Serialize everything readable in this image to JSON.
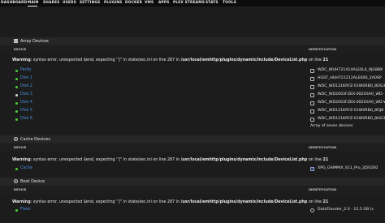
{
  "nav": [
    "DASHBOARD",
    "MAIN",
    "SHARES",
    "USERS",
    "SETTINGS",
    "PLUGINS",
    "DOCKER",
    "VMS",
    "APPS",
    "PLEX STREAMS",
    "STATS",
    "TOOLS"
  ],
  "columns": {
    "device": "DEVICE",
    "identification": "IDENTIFICATION"
  },
  "warning": {
    "label": "Warning",
    "text": ": syntax error, unexpected $end, expecting '']'' in state/sec.ini on line 287 in ",
    "path": "/usr/local/emhttp/plugins/dynamix/include/DeviceList.php",
    "line_prefix": " on line ",
    "line": "21"
  },
  "array": {
    "title": "Array Devices",
    "devices": [
      {
        "name": "Parity",
        "ident": "WDC_WUH721414ALE6L4_9JG8BK",
        "status": "green"
      },
      {
        "name": "Disk 1",
        "ident": "HGST_HUH721212ALE600_2A0SP",
        "status": "green"
      },
      {
        "name": "Disk 2",
        "ident": "WDC_WD121KRYZ-01W0RB0_8DG3",
        "status": "green"
      },
      {
        "name": "Disk 3",
        "ident": "WDC_WD2003FZEX-00Z4SA0_WD-",
        "status": "grey"
      },
      {
        "name": "Disk 4",
        "ident": "WDC_WD2003FZEX-00Z4SA0_WD-W",
        "status": "green"
      },
      {
        "name": "Disk 5",
        "ident": "WDC_WD121KRYZ-01W0RB0_8DJ8",
        "status": "green"
      },
      {
        "name": "Disk 6",
        "ident": "WDC_WD121KRYZ-01W0RB0_8HG3",
        "status": "green"
      }
    ],
    "summary": "Array of seven devices"
  },
  "cache": {
    "title": "Cache Devices",
    "devices": [
      {
        "name": "Cache",
        "ident": "XPG_GAMMIX_S11_Pro_2J50200",
        "status": "green"
      }
    ]
  },
  "boot": {
    "title": "Boot Device",
    "devices": [
      {
        "name": "Flash",
        "ident": "DataTraveler_2.0 - 15.5 GB (s",
        "status": "green"
      }
    ]
  }
}
